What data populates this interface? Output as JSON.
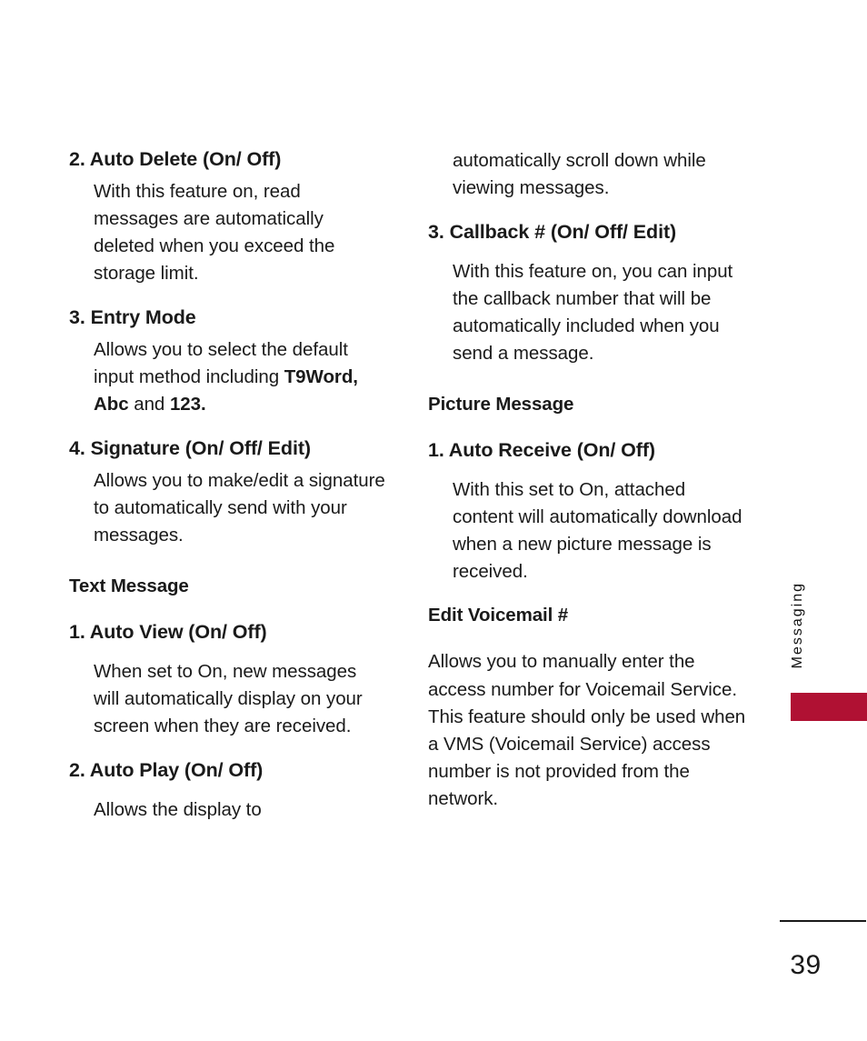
{
  "page": {
    "number": "39",
    "side_tab_label": "Messaging",
    "accent_color": "#b01133",
    "text_color": "#1a1a1a"
  },
  "left_column": {
    "blocks": [
      {
        "kind": "item-title",
        "text": "2. Auto Delete (On/ Off)"
      },
      {
        "kind": "item-body",
        "text": "With this feature on, read messages are automatically deleted when you exceed the storage limit."
      },
      {
        "kind": "item-title",
        "text": "3. Entry Mode"
      },
      {
        "kind": "item-body-rich",
        "parts": [
          {
            "text": "Allows you to select the default input method including ",
            "bold": false
          },
          {
            "text": "T9Word, Abc",
            "bold": true
          },
          {
            "text": " and ",
            "bold": false
          },
          {
            "text": "123.",
            "bold": true
          }
        ]
      },
      {
        "kind": "item-title",
        "text": "4. Signature (On/ Off/ Edit)"
      },
      {
        "kind": "item-body",
        "text": "Allows you to make/edit a signature to automatically send with your messages."
      },
      {
        "kind": "section-heading",
        "text": "Text Message"
      },
      {
        "kind": "item-title",
        "text": "1. Auto View (On/ Off)"
      },
      {
        "kind": "item-body",
        "text": "When set to On, new messages will automatically display on your screen when they are received."
      },
      {
        "kind": "item-title",
        "text": "2. Auto Play (On/ Off)"
      },
      {
        "kind": "item-body",
        "text": "Allows the display to"
      }
    ]
  },
  "right_column": {
    "blocks": [
      {
        "kind": "continuation-body",
        "text": "automatically scroll down while viewing messages."
      },
      {
        "kind": "item-title",
        "text": "3. Callback # (On/ Off/ Edit)"
      },
      {
        "kind": "item-body",
        "text": "With this feature on, you can input the callback number that will be automatically included when you send a message."
      },
      {
        "kind": "section-heading",
        "text": "Picture Message"
      },
      {
        "kind": "item-title",
        "text": "1. Auto Receive (On/ Off)"
      },
      {
        "kind": "item-body",
        "text": "With this set to On, attached content will automatically download when a new picture message is received."
      },
      {
        "kind": "section-heading",
        "text": "Edit Voicemail #"
      },
      {
        "kind": "flush-body",
        "text": "Allows you to manually enter the access number for Voicemail Service. This feature should only be used when a VMS (Voicemail Service) access number is not provided from the network."
      }
    ]
  }
}
